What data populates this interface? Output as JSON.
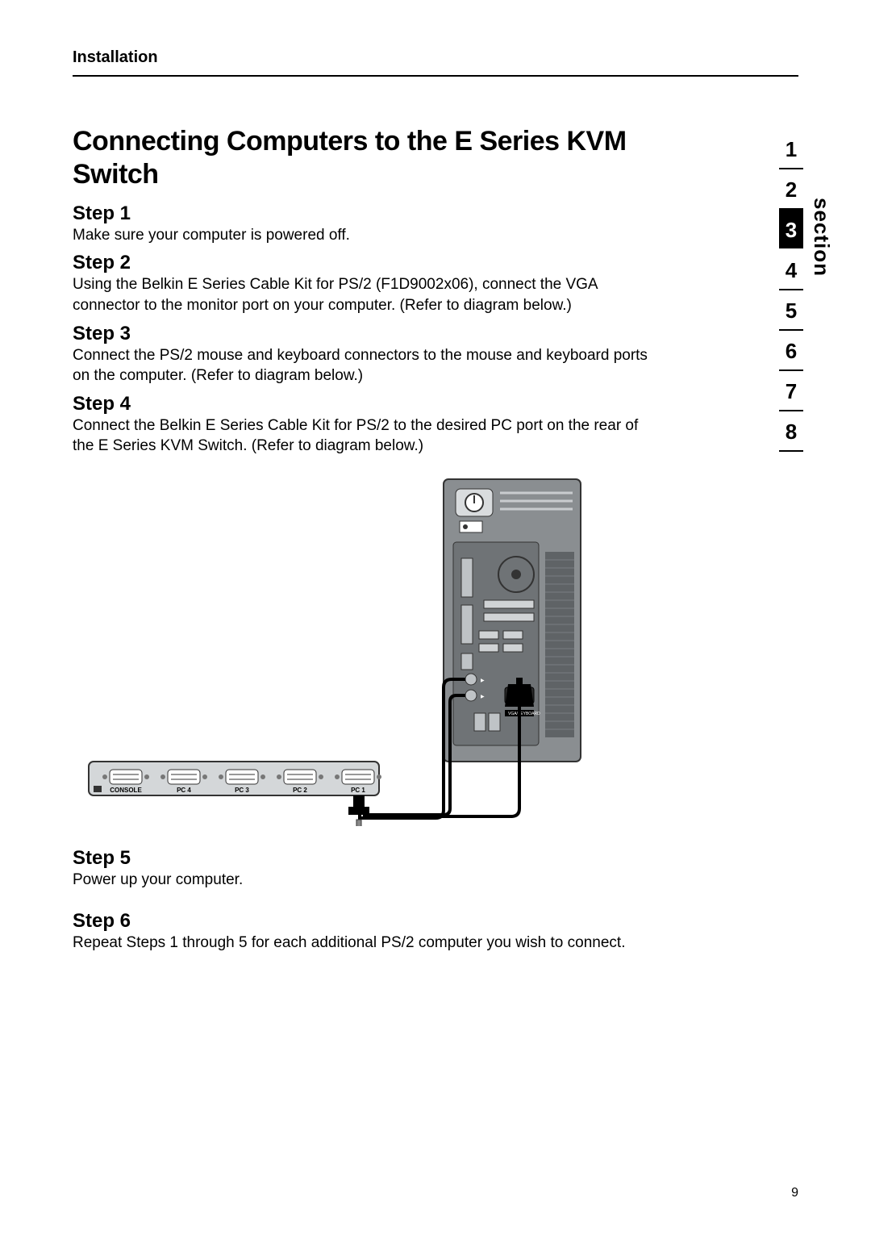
{
  "header": {
    "label": "Installation"
  },
  "title": "Connecting Computers to the E Series KVM Switch",
  "steps": [
    {
      "heading": "Step 1",
      "body": "Make sure your computer is powered off."
    },
    {
      "heading": "Step 2",
      "body": "Using the Belkin E Series Cable Kit for PS/2 (F1D9002x06), connect the VGA connector to the monitor port on your computer. (Refer to diagram below.)"
    },
    {
      "heading": "Step 3",
      "body": "Connect the PS/2 mouse and keyboard connectors to the mouse and keyboard ports on the computer. (Refer to diagram below.)"
    },
    {
      "heading": "Step 4",
      "body": "Connect the Belkin E Series Cable Kit for PS/2 to the desired PC port on the rear of the E Series KVM Switch. (Refer to diagram below.)"
    },
    {
      "heading": "Step 5",
      "body": "Power up your computer."
    },
    {
      "heading": "Step 6",
      "body": "Repeat Steps 1 through 5 for each additional PS/2 computer you wish to connect."
    }
  ],
  "sectionNav": {
    "label": "section",
    "items": [
      "1",
      "2",
      "3",
      "4",
      "5",
      "6",
      "7",
      "8"
    ],
    "activeIndex": 2
  },
  "diagram": {
    "kvmPorts": [
      "CONSOLE",
      "PC 4",
      "PC 3",
      "PC 2",
      "PC 1"
    ],
    "pcLabel": "VGA/KEYBOARD"
  },
  "pageNumber": "9"
}
